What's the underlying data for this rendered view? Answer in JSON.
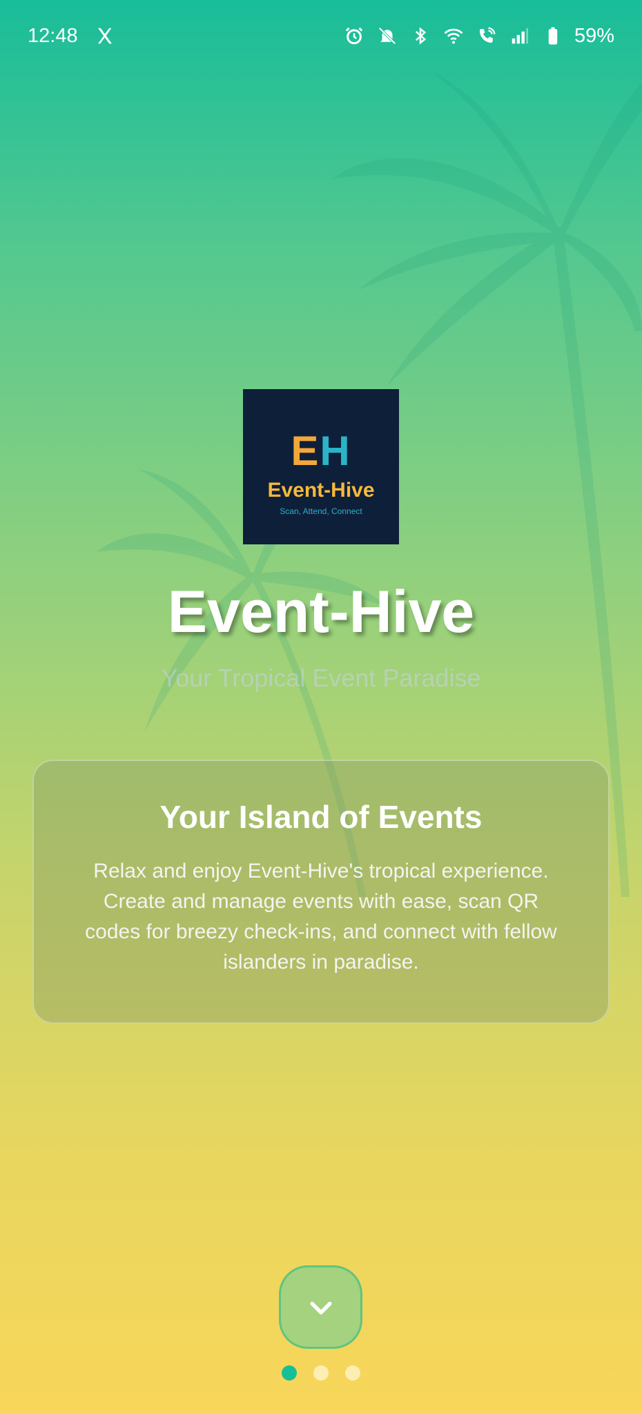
{
  "status_bar": {
    "time": "12:48",
    "battery": "59%",
    "icons": [
      "x-logo-icon",
      "alarm-icon",
      "mute-icon",
      "bluetooth-icon",
      "wifi-icon",
      "wifi-calling-icon",
      "signal-icon",
      "battery-icon"
    ]
  },
  "logo": {
    "mark_e": "E",
    "mark_h": "H",
    "name": "Event-Hive",
    "tagline": "Scan, Attend, Connect"
  },
  "hero": {
    "title": "Event-Hive",
    "subtitle": "Your Tropical Event Paradise"
  },
  "card": {
    "title": "Your Island of Events",
    "body": "Relax and enjoy Event-Hive's tropical experience. Create and manage events with ease, scan QR codes for breezy check-ins, and connect with fellow islanders in paradise."
  },
  "pager": {
    "total_pages": 3,
    "current_page": 1
  },
  "colors": {
    "accent": "#17bf97",
    "logo_bg": "#0e1f3a",
    "logo_orange": "#f3a73a",
    "logo_teal": "#2bb3c7"
  }
}
